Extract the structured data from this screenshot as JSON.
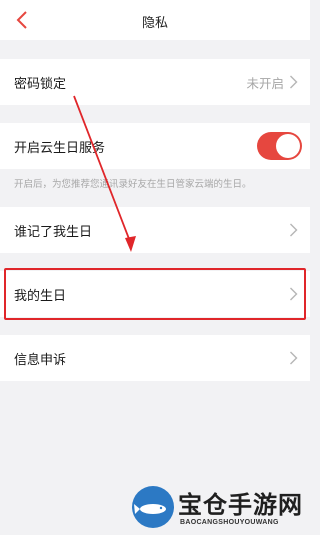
{
  "nav": {
    "title": "隐私",
    "back_icon": "chevron-left-icon"
  },
  "rows": {
    "password_lock": {
      "label": "密码锁定",
      "value": "未开启"
    },
    "cloud_birthday": {
      "label": "开启云生日服务",
      "toggle_on": true
    },
    "hint": "开启后，为您推荐您通讯录好友在生日管家云端的生日。",
    "who_remembered": {
      "label": "谁记了我生日"
    },
    "my_birthday": {
      "label": "我的生日"
    },
    "complaint": {
      "label": "信息申诉"
    }
  },
  "colors": {
    "accent": "#e6473f",
    "annotation": "#e0262a",
    "background": "#f2f2f4"
  },
  "watermark": {
    "title": "宝仓手游网",
    "subtitle": "BAOCANGSHOUYOUWANG"
  }
}
